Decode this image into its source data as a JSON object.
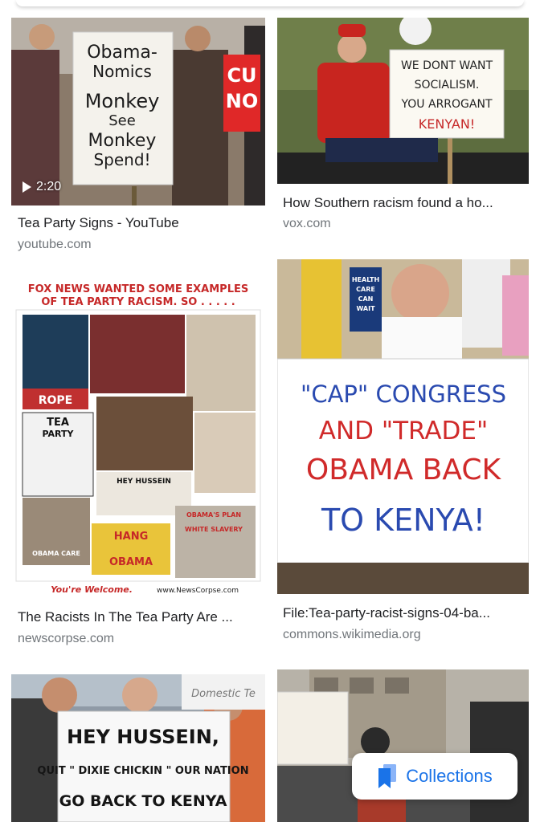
{
  "results": [
    {
      "title": "Tea Party Signs - YouTube",
      "source": "youtube.com",
      "duration": "2:20",
      "sign_lines": [
        "Obama-",
        "Nomics",
        "Monkey",
        "See",
        "Monkey",
        "Spend!"
      ],
      "side_sign": [
        "CU",
        "NO"
      ]
    },
    {
      "title": "How Southern racism found a ho...",
      "source": "vox.com",
      "sign_lines": [
        "WE DONT WANT",
        "SOCIALISM.",
        "YOU ARROGANT",
        "KENYAN!"
      ]
    },
    {
      "title": "The Racists In The Tea Party Are ...",
      "source": "newscorpse.com",
      "poster_header": [
        "FOX NEWS WANTED SOME EXAMPLES",
        "OF TEA PARTY RACISM. SO . . . . ."
      ],
      "poster_footer": [
        "You're Welcome.",
        "www.NewsCorpse.com"
      ],
      "poster_labels": [
        "ROPE",
        "TEA",
        "PARTY",
        "HEY HUSSEIN",
        "HANG",
        "OBAMA",
        "OBAMA CARE",
        "OBAMA'S PLAN",
        "WHITE SLAVERY"
      ]
    },
    {
      "title": "File:Tea-party-racist-signs-04-ba...",
      "source": "commons.wikimedia.org",
      "sign_lines": [
        "\"CAP\" CONGRESS",
        "AND \"TRADE\"",
        "OBAMA BACK",
        "TO KENYA!"
      ],
      "small_sign": [
        "HEALTH",
        "CARE",
        "CAN",
        "WAIT"
      ]
    },
    {
      "sign_lines": [
        "HEY HUSSEIN,",
        "QUIT \" DIXIE CHICKIN \" OUR NATION",
        "GO BACK TO KENYA"
      ],
      "bg_sign": "Domestic Te"
    },
    {}
  ],
  "collections": {
    "label": "Collections",
    "icon": "bookmark-icon"
  },
  "colors": {
    "accent": "#1a73e8",
    "title": "#202124",
    "source": "#70757a"
  }
}
